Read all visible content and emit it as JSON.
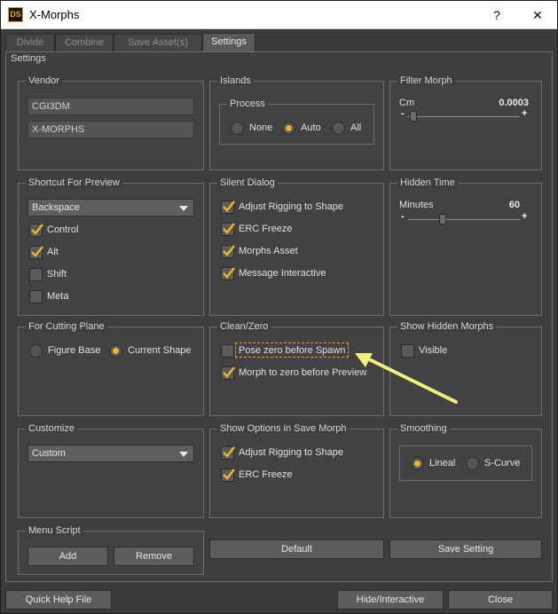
{
  "window": {
    "title": "X-Morphs",
    "logo_text": "DS",
    "help_glyph": "?",
    "close_glyph": "✕"
  },
  "tabs": [
    {
      "label": "Divide"
    },
    {
      "label": "Combine"
    },
    {
      "label": "Save Asset(s)"
    },
    {
      "label": "Settings",
      "active": true
    }
  ],
  "settings": {
    "title": "Settings",
    "vendor": {
      "title": "Vendor",
      "field1": "CGI3DM",
      "field2": "X-MORPHS"
    },
    "islands": {
      "title": "Islands",
      "process_title": "Process",
      "options": [
        {
          "label": "None",
          "selected": false
        },
        {
          "label": "Auto",
          "selected": true
        },
        {
          "label": "All",
          "selected": false
        }
      ]
    },
    "filter_morph": {
      "title": "Filter Morph",
      "unit": "Cm",
      "value": "0.0003",
      "fraction": 0.02,
      "minus": "-",
      "plus": "+"
    },
    "shortcut": {
      "title": "Shortcut For Preview",
      "key": "Backspace",
      "modifiers": [
        {
          "label": "Control",
          "checked": true
        },
        {
          "label": "Alt",
          "checked": true
        },
        {
          "label": "Shift",
          "checked": false
        },
        {
          "label": "Meta",
          "checked": false
        }
      ]
    },
    "silent_dialog": {
      "title": "Silent Dialog",
      "items": [
        {
          "label": "Adjust Rigging to Shape",
          "checked": true
        },
        {
          "label": "ERC Freeze",
          "checked": true
        },
        {
          "label": "Morphs Asset",
          "checked": true
        },
        {
          "label": "Message Interactive",
          "checked": true
        }
      ]
    },
    "hidden_time": {
      "title": "Hidden Time",
      "unit": "Minutes",
      "value": "60",
      "fraction": 0.3,
      "minus": "-",
      "plus": "+"
    },
    "cutting_plane": {
      "title": "For Cutting Plane",
      "options": [
        {
          "label": "Figure Base",
          "selected": false
        },
        {
          "label": "Current Shape",
          "selected": true
        }
      ]
    },
    "clean_zero": {
      "title": "Clean/Zero",
      "items": [
        {
          "label": "Pose zero before Spawn",
          "checked": false
        },
        {
          "label": "Morph to zero before Preview",
          "checked": true
        }
      ]
    },
    "show_hidden": {
      "title": "Show Hidden Morphs",
      "visible_label": "Visible",
      "checked": false
    },
    "customize": {
      "title": "Customize",
      "value": "Custom"
    },
    "show_options": {
      "title": "Show Options in Save Morph",
      "items": [
        {
          "label": "Adjust Rigging to Shape",
          "checked": true
        },
        {
          "label": "ERC Freeze",
          "checked": true
        }
      ]
    },
    "smoothing": {
      "title": "Smoothing",
      "options": [
        {
          "label": "Lineal",
          "selected": true
        },
        {
          "label": "S-Curve",
          "selected": false
        }
      ]
    },
    "menu_script": {
      "title": "Menu Script",
      "add_label": "Add",
      "remove_label": "Remove"
    },
    "default_label": "Default",
    "save_setting_label": "Save Setting"
  },
  "footer": {
    "quick_help": "Quick Help File",
    "hide_interactive": "Hide/Interactive",
    "close": "Close"
  },
  "colors": {
    "accent": "#f2b41c",
    "panel": "#3e3e3e",
    "titlebar": "#ffffff"
  }
}
